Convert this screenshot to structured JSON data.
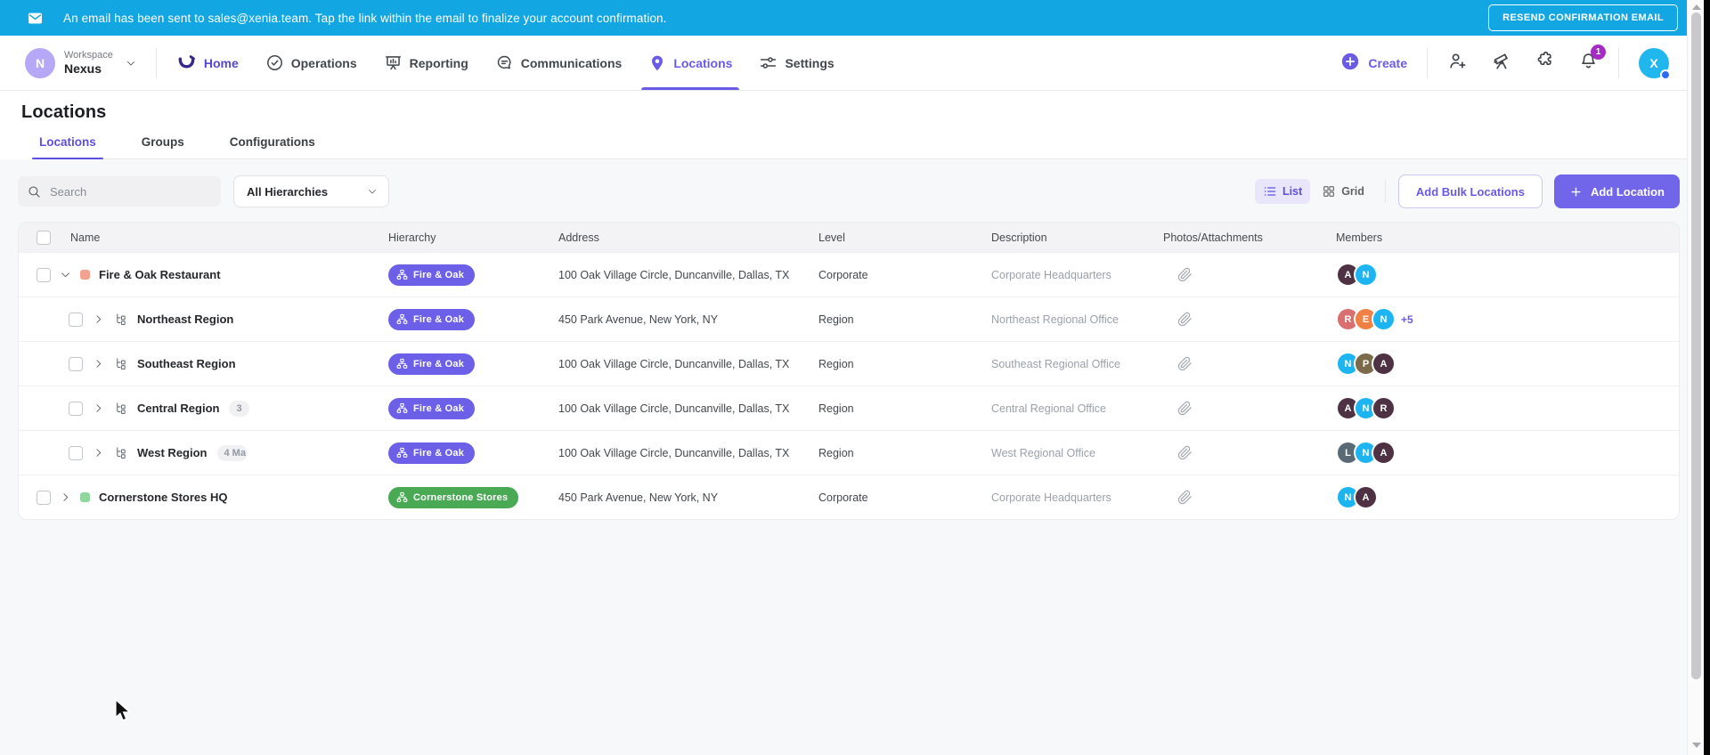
{
  "colors": {
    "banner_bg": "#12a6e3",
    "primary_purple": "#6a5ae8",
    "pill_fire_oak": "#6c5fe8",
    "pill_cornerstone": "#49a954",
    "notification_badge": "#a42cc4"
  },
  "banner": {
    "message": "An email has been sent to sales@xenia.team. Tap the link within the email to finalize your account confirmation.",
    "resend_button": "RESEND CONFIRMATION EMAIL"
  },
  "navbar": {
    "workspace": {
      "label": "Workspace",
      "name": "Nexus",
      "avatar_letter": "N"
    },
    "items": [
      {
        "label": "Home",
        "icon": "xenia",
        "style": "brand",
        "active": false
      },
      {
        "label": "Operations",
        "icon": "check-circle",
        "active": false
      },
      {
        "label": "Reporting",
        "icon": "presentation",
        "active": false
      },
      {
        "label": "Communications",
        "icon": "chat",
        "active": false
      },
      {
        "label": "Locations",
        "icon": "map-pin",
        "active": true
      },
      {
        "label": "Settings",
        "icon": "sliders",
        "active": false
      }
    ],
    "create_label": "Create",
    "notification_count": "1",
    "user_avatar_letter": "X"
  },
  "page": {
    "title": "Locations",
    "tabs": [
      {
        "label": "Locations",
        "active": true
      },
      {
        "label": "Groups",
        "active": false
      },
      {
        "label": "Configurations",
        "active": false
      }
    ]
  },
  "toolbar": {
    "search_placeholder": "Search",
    "hierarchy_filter": "All Hierarchies",
    "view_toggle": {
      "list": "List",
      "grid": "Grid",
      "active": "List"
    },
    "add_bulk_label": "Add Bulk Locations",
    "add_location_label": "Add Location"
  },
  "table": {
    "columns": [
      "Name",
      "Hierarchy",
      "Address",
      "Level",
      "Description",
      "Photos/Attachments",
      "Members"
    ],
    "rows": [
      {
        "name": "Fire & Oak Restaurant",
        "depth": 0,
        "expanded": true,
        "icon_color": "#f2a28e",
        "hierarchy": {
          "label": "Fire & Oak",
          "color": "#6c5fe8"
        },
        "address": "100 Oak Village Circle, Duncanville, Dallas, TX",
        "level": "Corporate",
        "description": "Corporate Headquarters",
        "members": [
          {
            "initial": "A",
            "color": "#4e3142"
          },
          {
            "initial": "N",
            "color": "#1cb5f2"
          }
        ],
        "members_more": "",
        "suffix_badge": ""
      },
      {
        "name": "Northeast Region",
        "depth": 1,
        "expanded": false,
        "icon_color": "",
        "hierarchy": {
          "label": "Fire & Oak",
          "color": "#6c5fe8"
        },
        "address": "450 Park Avenue, New York, NY",
        "level": "Region",
        "description": "Northeast Regional Office",
        "members": [
          {
            "initial": "R",
            "color": "#d96f6f"
          },
          {
            "initial": "E",
            "color": "#f08044"
          },
          {
            "initial": "N",
            "color": "#1cb5f2"
          }
        ],
        "members_more": "+5",
        "suffix_badge": ""
      },
      {
        "name": "Southeast Region",
        "depth": 1,
        "expanded": false,
        "icon_color": "",
        "hierarchy": {
          "label": "Fire & Oak",
          "color": "#6c5fe8"
        },
        "address": "100 Oak Village Circle, Duncanville, Dallas, TX",
        "level": "Region",
        "description": "Southeast Regional Office",
        "members": [
          {
            "initial": "N",
            "color": "#1cb5f2"
          },
          {
            "initial": "P",
            "color": "#7c6b4a"
          },
          {
            "initial": "A",
            "color": "#4e3142"
          }
        ],
        "members_more": "",
        "suffix_badge": ""
      },
      {
        "name": "Central Region",
        "depth": 1,
        "expanded": false,
        "icon_color": "",
        "hierarchy": {
          "label": "Fire & Oak",
          "color": "#6c5fe8"
        },
        "address": "100 Oak Village Circle, Duncanville, Dallas, TX",
        "level": "Region",
        "description": "Central Regional Office",
        "members": [
          {
            "initial": "A",
            "color": "#4e3142"
          },
          {
            "initial": "N",
            "color": "#1cb5f2"
          },
          {
            "initial": "R",
            "color": "#4e3142"
          }
        ],
        "members_more": "",
        "suffix_badge": "3"
      },
      {
        "name": "West Region",
        "depth": 1,
        "expanded": false,
        "icon_color": "",
        "hierarchy": {
          "label": "Fire & Oak",
          "color": "#6c5fe8"
        },
        "address": "100 Oak Village Circle, Duncanville, Dallas, TX",
        "level": "Region",
        "description": "West Regional Office",
        "members": [
          {
            "initial": "L",
            "color": "#596a76"
          },
          {
            "initial": "N",
            "color": "#1cb5f2"
          },
          {
            "initial": "A",
            "color": "#4e3142"
          }
        ],
        "members_more": "",
        "suffix_badge": "4 Ma"
      },
      {
        "name": "Cornerstone Stores HQ",
        "depth": 0,
        "expanded": false,
        "icon_color": "#8fd79c",
        "hierarchy": {
          "label": "Cornerstone Stores",
          "color": "#49a954"
        },
        "address": "450 Park Avenue, New York, NY",
        "level": "Corporate",
        "description": "Corporate Headquarters",
        "members": [
          {
            "initial": "N",
            "color": "#1cb5f2"
          },
          {
            "initial": "A",
            "color": "#4e3142"
          }
        ],
        "members_more": "",
        "suffix_badge": ""
      }
    ]
  }
}
